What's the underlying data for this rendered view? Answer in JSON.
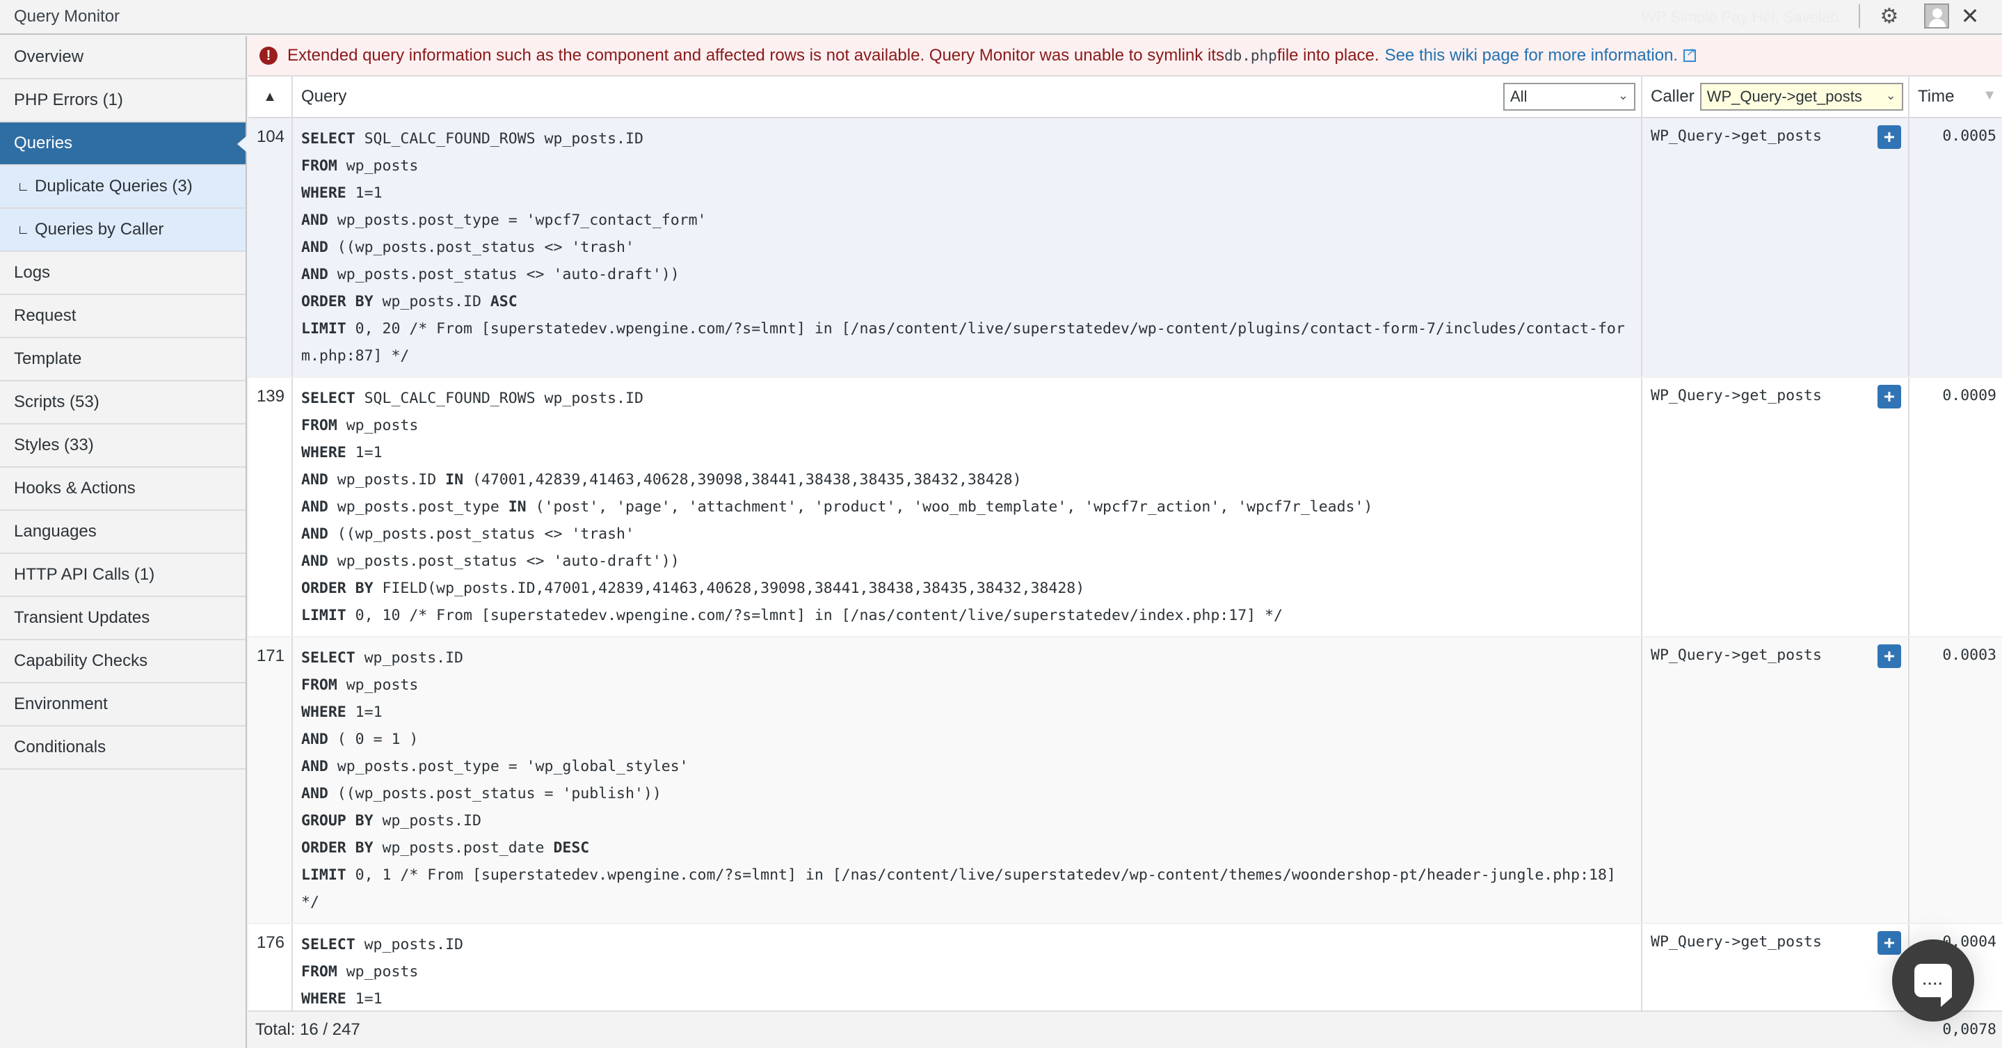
{
  "window": {
    "title": "Query Monitor",
    "ghost_text": "WP Simple Pay   Hei, Savelab",
    "icons": [
      "gear-icon",
      "avatar-icon",
      "close-icon"
    ]
  },
  "sidebar": {
    "items": [
      {
        "label": "Overview",
        "type": "item"
      },
      {
        "label": "PHP Errors (1)",
        "type": "item"
      },
      {
        "label": "Queries",
        "type": "active"
      },
      {
        "label": "Duplicate Queries (3)",
        "type": "sub"
      },
      {
        "label": "Queries by Caller",
        "type": "sub"
      },
      {
        "label": "Logs",
        "type": "item"
      },
      {
        "label": "Request",
        "type": "item"
      },
      {
        "label": "Template",
        "type": "item"
      },
      {
        "label": "Scripts (53)",
        "type": "item"
      },
      {
        "label": "Styles (33)",
        "type": "item"
      },
      {
        "label": "Hooks & Actions",
        "type": "item"
      },
      {
        "label": "Languages",
        "type": "item"
      },
      {
        "label": "HTTP API Calls (1)",
        "type": "item"
      },
      {
        "label": "Transient Updates",
        "type": "item"
      },
      {
        "label": "Capability Checks",
        "type": "item"
      },
      {
        "label": "Environment",
        "type": "item"
      },
      {
        "label": "Conditionals",
        "type": "item"
      }
    ]
  },
  "notice": {
    "text_before": "Extended query information such as the component and affected rows is not available. Query Monitor was unable to symlink its ",
    "code": "db.php",
    "text_after": " file into place.",
    "link": "See this wiki page for more information.",
    "color": "#8a1a1a"
  },
  "table": {
    "headers": {
      "sort_indicator": "▲",
      "query": "Query",
      "query_filter": "All",
      "caller": "Caller",
      "caller_filter": "WP_Query->get_posts",
      "time": "Time",
      "time_sort": "▼"
    },
    "rows": [
      {
        "num": "104",
        "lines": [
          [
            [
              "kw",
              "SELECT"
            ],
            [
              "t",
              " SQL_CALC_FOUND_ROWS wp_posts.ID"
            ]
          ],
          [
            [
              "kw",
              "FROM"
            ],
            [
              "t",
              " wp_posts"
            ]
          ],
          [
            [
              "kw",
              "WHERE"
            ],
            [
              "t",
              " 1=1"
            ]
          ],
          [
            [
              "kw",
              "AND"
            ],
            [
              "t",
              " wp_posts.post_type = 'wpcf7_contact_form'"
            ]
          ],
          [
            [
              "kw",
              "AND"
            ],
            [
              "t",
              " ((wp_posts.post_status <> 'trash'"
            ]
          ],
          [
            [
              "kw",
              "AND"
            ],
            [
              "t",
              " wp_posts.post_status <> 'auto-draft'))"
            ]
          ],
          [
            [
              "kw",
              "ORDER BY"
            ],
            [
              "t",
              " wp_posts.ID "
            ],
            [
              "kw",
              "ASC"
            ]
          ],
          [
            [
              "kw",
              "LIMIT"
            ],
            [
              "t",
              " 0, 20 /* From [superstatedev.wpengine.com/?s=lmnt] in [/nas/content/live/superstatedev/wp-content/plugins/contact-form-7/includes/contact-form.php:87] */"
            ]
          ]
        ],
        "caller": "WP_Query->get_posts",
        "time": "0.0005"
      },
      {
        "num": "139",
        "lines": [
          [
            [
              "kw",
              "SELECT"
            ],
            [
              "t",
              " SQL_CALC_FOUND_ROWS wp_posts.ID"
            ]
          ],
          [
            [
              "kw",
              "FROM"
            ],
            [
              "t",
              " wp_posts"
            ]
          ],
          [
            [
              "kw",
              "WHERE"
            ],
            [
              "t",
              " 1=1"
            ]
          ],
          [
            [
              "kw",
              "AND"
            ],
            [
              "t",
              " wp_posts.ID "
            ],
            [
              "kw",
              "IN"
            ],
            [
              "t",
              " (47001,42839,41463,40628,39098,38441,38438,38435,38432,38428)"
            ]
          ],
          [
            [
              "kw",
              "AND"
            ],
            [
              "t",
              " wp_posts.post_type "
            ],
            [
              "kw",
              "IN"
            ],
            [
              "t",
              " ('post', 'page', 'attachment', 'product', 'woo_mb_template', 'wpcf7r_action', 'wpcf7r_leads')"
            ]
          ],
          [
            [
              "kw",
              "AND"
            ],
            [
              "t",
              " ((wp_posts.post_status <> 'trash'"
            ]
          ],
          [
            [
              "kw",
              "AND"
            ],
            [
              "t",
              " wp_posts.post_status <> 'auto-draft'))"
            ]
          ],
          [
            [
              "kw",
              "ORDER BY"
            ],
            [
              "t",
              " FIELD(wp_posts.ID,47001,42839,41463,40628,39098,38441,38438,38435,38432,38428)"
            ]
          ],
          [
            [
              "kw",
              "LIMIT"
            ],
            [
              "t",
              " 0, 10 /* From [superstatedev.wpengine.com/?s=lmnt] in [/nas/content/live/superstatedev/index.php:17] */"
            ]
          ]
        ],
        "caller": "WP_Query->get_posts",
        "time": "0.0009"
      },
      {
        "num": "171",
        "lines": [
          [
            [
              "kw",
              "SELECT"
            ],
            [
              "t",
              " wp_posts.ID"
            ]
          ],
          [
            [
              "kw",
              "FROM"
            ],
            [
              "t",
              " wp_posts"
            ]
          ],
          [
            [
              "kw",
              "WHERE"
            ],
            [
              "t",
              " 1=1"
            ]
          ],
          [
            [
              "kw",
              "AND"
            ],
            [
              "t",
              " ( 0 = 1 )"
            ]
          ],
          [
            [
              "kw",
              "AND"
            ],
            [
              "t",
              " wp_posts.post_type = 'wp_global_styles'"
            ]
          ],
          [
            [
              "kw",
              "AND"
            ],
            [
              "t",
              " ((wp_posts.post_status = 'publish'))"
            ]
          ],
          [
            [
              "kw",
              "GROUP BY"
            ],
            [
              "t",
              " wp_posts.ID"
            ]
          ],
          [
            [
              "kw",
              "ORDER BY"
            ],
            [
              "t",
              " wp_posts.post_date "
            ],
            [
              "kw",
              "DESC"
            ]
          ],
          [
            [
              "kw",
              "LIMIT"
            ],
            [
              "t",
              " 0, 1 /* From [superstatedev.wpengine.com/?s=lmnt] in [/nas/content/live/superstatedev/wp-content/themes/woondershop-pt/header-jungle.php:18]\n*/"
            ]
          ]
        ],
        "caller": "WP_Query->get_posts",
        "time": "0.0003"
      },
      {
        "num": "176",
        "lines": [
          [
            [
              "kw",
              "SELECT"
            ],
            [
              "t",
              " wp_posts.ID"
            ]
          ],
          [
            [
              "kw",
              "FROM"
            ],
            [
              "t",
              " wp_posts"
            ]
          ],
          [
            [
              "kw",
              "WHERE"
            ],
            [
              "t",
              " 1=1"
            ]
          ]
        ],
        "caller": "WP_Query->get_posts",
        "time": "0.0004"
      }
    ],
    "expand_label": "+",
    "footer": {
      "total": "Total: 16 / 247",
      "time_sum": "0,0078"
    }
  },
  "chat": {
    "icon": "chat-bubble-icon",
    "dots": "...."
  },
  "colors": {
    "accent": "#2f6ea3",
    "button": "#3074b5",
    "row_highlight": "#f0f2f9",
    "submenu_bg": "#deebfa",
    "notice_bg": "#fcf0f1",
    "filter_highlight": "#ffffe0"
  }
}
